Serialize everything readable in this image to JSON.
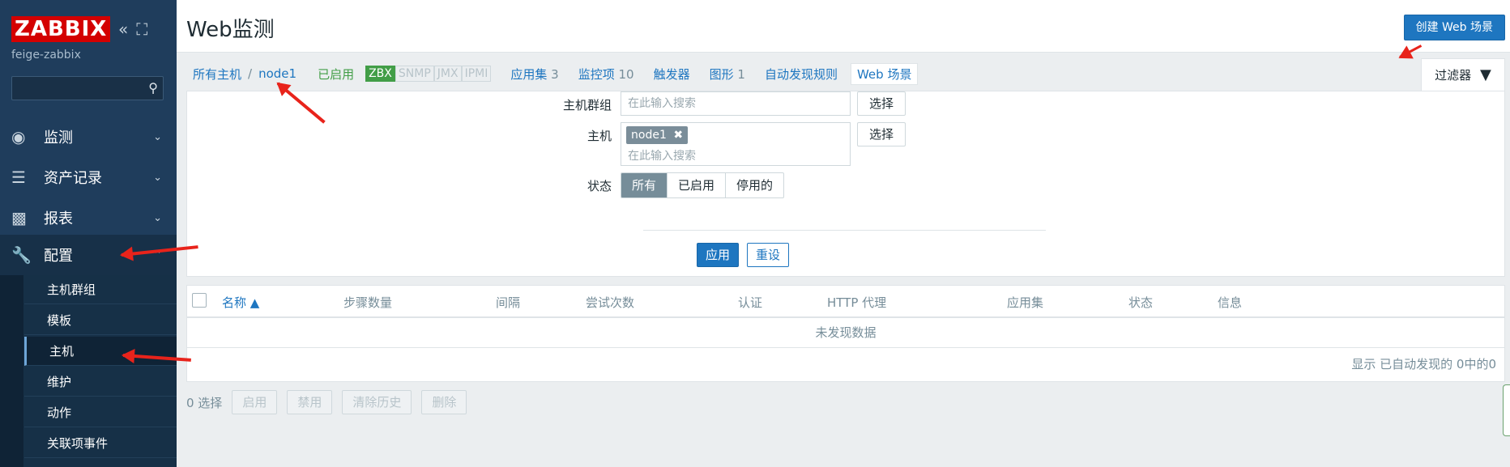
{
  "sidebar": {
    "logo": "ZABBIX",
    "server_name": "feige-zabbix",
    "search_value": "",
    "menu": [
      {
        "label": "监测",
        "icon": "eye-icon"
      },
      {
        "label": "资产记录",
        "icon": "list-icon"
      },
      {
        "label": "报表",
        "icon": "bar-chart-icon"
      },
      {
        "label": "配置",
        "icon": "wrench-icon"
      }
    ],
    "submenu": [
      "主机群组",
      "模板",
      "主机",
      "维护",
      "动作",
      "关联项事件"
    ]
  },
  "header": {
    "title": "Web监测",
    "create_button": "创建 Web 场景"
  },
  "nav": {
    "all_hosts": "所有主机",
    "separator": "/",
    "host": "node1",
    "status": "已启用",
    "tags": [
      "ZBX",
      "SNMP",
      "JMX",
      "IPMI"
    ],
    "tabs": [
      {
        "label": "应用集",
        "count": "3"
      },
      {
        "label": "监控项",
        "count": "10"
      },
      {
        "label": "触发器",
        "count": ""
      },
      {
        "label": "图形",
        "count": "1"
      },
      {
        "label": "自动发现规则",
        "count": ""
      },
      {
        "label": "Web 场景",
        "count": ""
      }
    ],
    "filter_tab": "过滤器"
  },
  "filter": {
    "host_group_label": "主机群组",
    "host_group_placeholder": "在此输入搜索",
    "host_label": "主机",
    "host_chip": "node1",
    "host_placeholder": "在此输入搜索",
    "select_button": "选择",
    "status_label": "状态",
    "status_options": [
      "所有",
      "已启用",
      "停用的"
    ],
    "status_selected": "所有",
    "apply_button": "应用",
    "reset_button": "重设"
  },
  "table": {
    "columns": [
      "名称 ▲",
      "步骤数量",
      "间隔",
      "尝试次数",
      "认证",
      "HTTP 代理",
      "应用集",
      "状态",
      "信息"
    ],
    "empty_text": "未发现数据",
    "footer": "显示 已自动发现的 0中的0"
  },
  "actions": {
    "selected": "0 选择",
    "buttons": [
      "启用",
      "禁用",
      "清除历史",
      "删除"
    ]
  },
  "colors": {
    "sidebar_bg": "#1f3d5c",
    "accent": "#1e76c0",
    "logo_red": "#d40000",
    "enabled_green": "#429e47",
    "annotation_red": "#e8231b"
  }
}
